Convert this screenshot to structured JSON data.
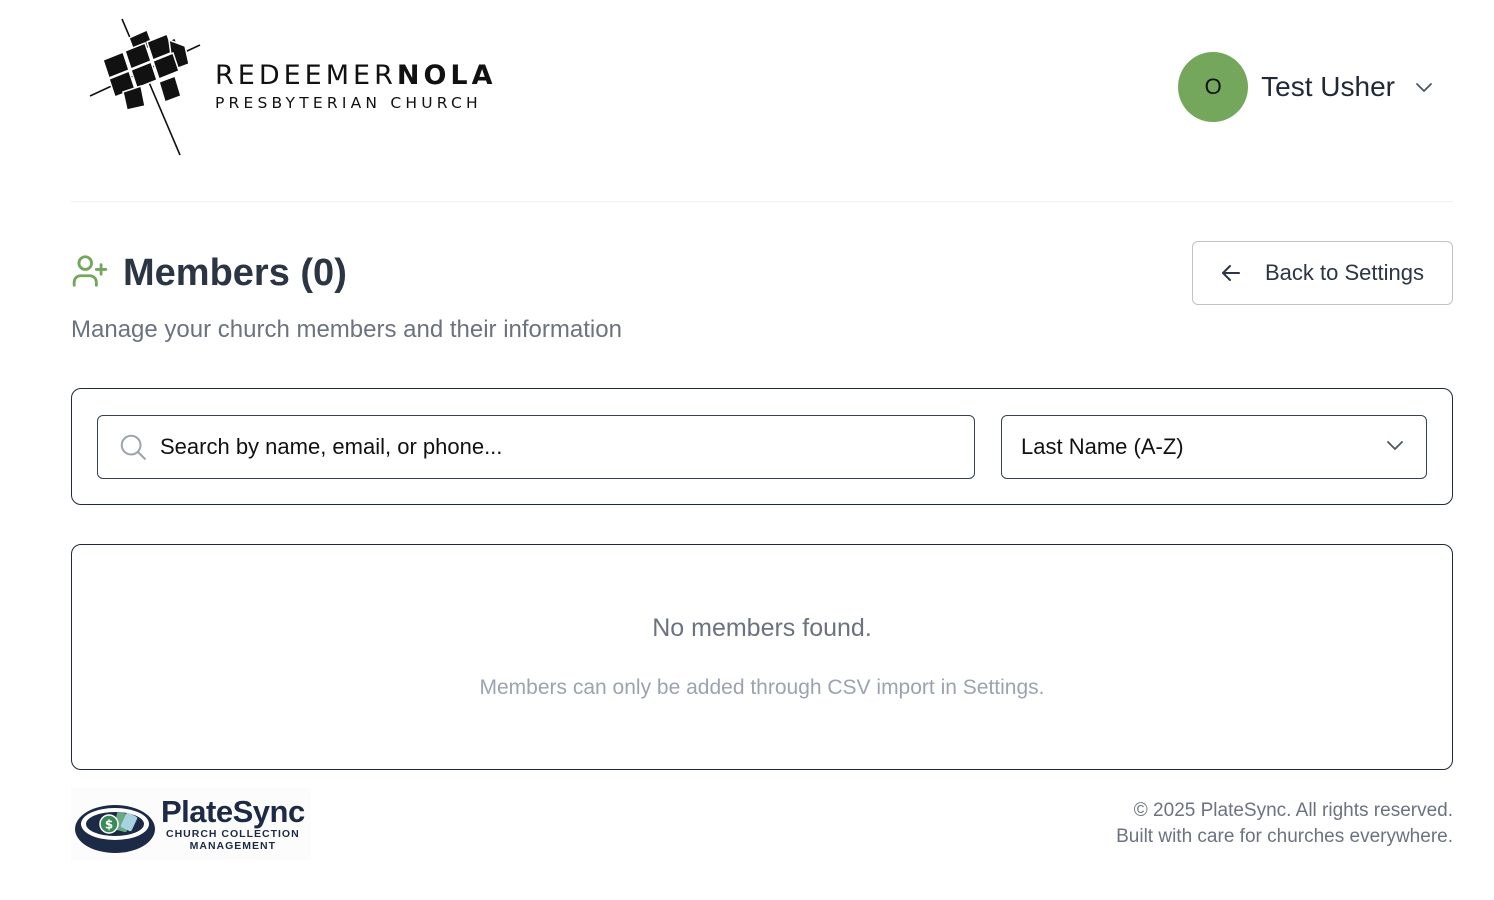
{
  "header": {
    "church_logo": {
      "name_light": "REDEEMER",
      "name_bold": "NOLA",
      "subtitle": "PRESBYTERIAN CHURCH"
    },
    "user": {
      "avatar_initial": "O",
      "name": "Test Usher",
      "avatar_color": "#74a75c"
    }
  },
  "page": {
    "title": "Members (0)",
    "subtitle": "Manage your church members and their information",
    "back_button_label": "Back to Settings",
    "accent_color": "#74a75c"
  },
  "filters": {
    "search_placeholder": "Search by name, email, or phone...",
    "search_value": "",
    "sort_selected": "Last Name (A-Z)"
  },
  "results": {
    "empty_title": "No members found.",
    "empty_note": "Members can only be added through CSV import in Settings."
  },
  "footer": {
    "brand_name": "PlateSync",
    "brand_tagline_line1": "CHURCH COLLECTION",
    "brand_tagline_line2": "MANAGEMENT",
    "copyright": "© 2025 PlateSync. All rights reserved.",
    "tagline": "Built with care for churches everywhere."
  },
  "icons": {
    "title_icon": "user-plus-icon",
    "back_icon": "arrow-left-icon",
    "search_icon": "search-icon",
    "sort_icon": "chevron-down-icon",
    "user_menu_icon": "chevron-down-icon"
  }
}
